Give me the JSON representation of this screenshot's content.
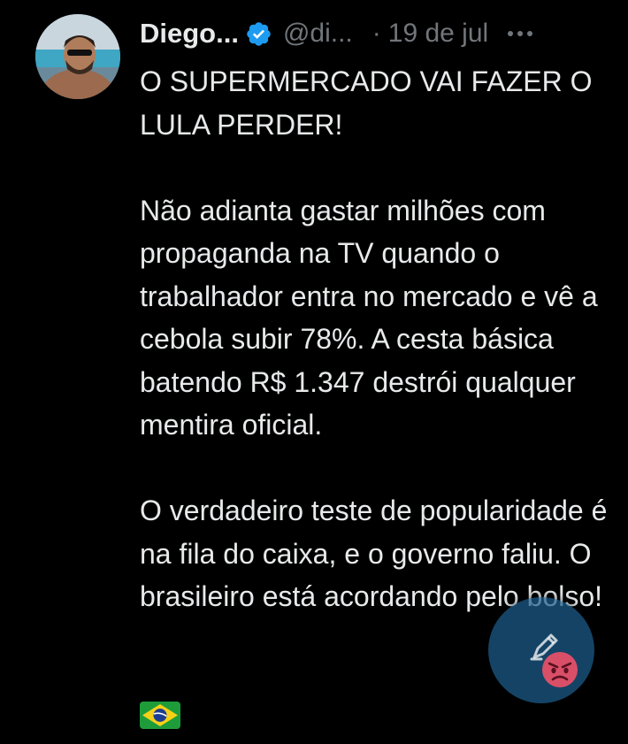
{
  "tweet": {
    "author_name": "Diego...",
    "handle": "@di...",
    "separator": "·",
    "date": "19 de jul",
    "icons": {
      "verified": "verified-badge-icon",
      "more": "more-options-icon",
      "flag": "brazil-flag-emoji",
      "compose": "compose-icon",
      "reaction": "angry-face-emoji"
    },
    "text": {
      "line1": "O SUPERMERCADO VAI FAZER O LULA PERDER!",
      "paragraph2": "Não adianta gastar milhões com propaganda na TV quando o trabalhador entra no mercado e vê a cebola subir 78%. A cesta básica batendo R$ 1.347 destrói qualquer mentira oficial.",
      "paragraph3": "O verdadeiro teste de popularidade é na fila do caixa, e o governo faliu. O brasileiro está acordando pelo bolso!"
    }
  },
  "colors": {
    "background": "#000000",
    "primary_text": "#e7e9ea",
    "secondary_text": "#71767b",
    "verified_blue": "#1d9bf0",
    "fab_blue": "#1d5d8c"
  }
}
